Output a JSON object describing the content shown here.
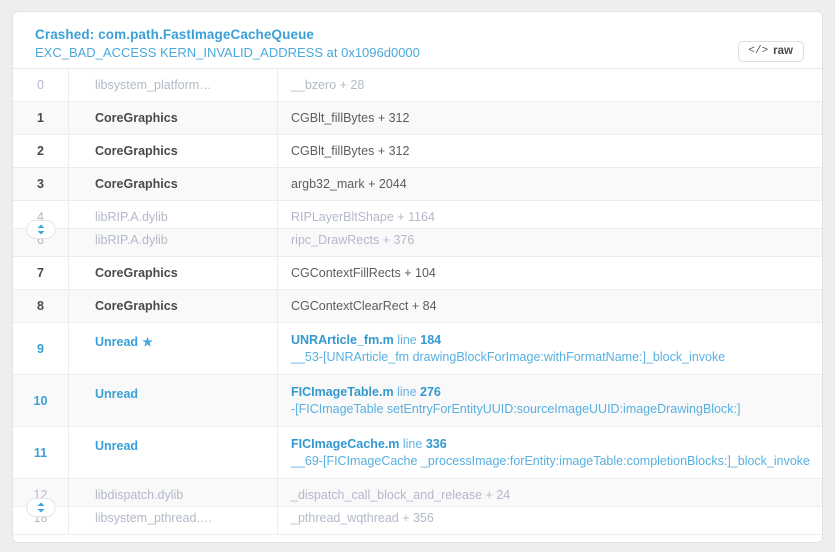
{
  "header": {
    "title": "Crashed: com.path.FastImageCacheQueue",
    "subtitle": "EXC_BAD_ACCESS KERN_INVALID_ADDRESS at 0x1096d0000",
    "raw_button": {
      "glyph": "</>",
      "label": "raw"
    },
    "colors": {
      "link": "#4aa9dd",
      "title": "#3aa0d8",
      "muted": "#b3b9c9",
      "emphasis": "#4a4a4a"
    }
  },
  "stack": {
    "rows": [
      {
        "index": "0",
        "library": "libsystem_platform…",
        "function": "__bzero + 28"
      },
      {
        "index": "1",
        "library": "CoreGraphics",
        "function": "CGBlt_fillBytes + 312"
      },
      {
        "index": "2",
        "library": "CoreGraphics",
        "function": "CGBlt_fillBytes + 312"
      },
      {
        "index": "3",
        "library": "CoreGraphics",
        "function": "argb32_mark + 2044"
      },
      {
        "index": "4",
        "library": "libRIP.A.dylib",
        "function": "RIPLayerBltShape + 1164"
      },
      {
        "index": "6",
        "library": "libRIP.A.dylib",
        "function": "ripc_DrawRects + 376"
      },
      {
        "index": "7",
        "library": "CoreGraphics",
        "function": "CGContextFillRects + 104"
      },
      {
        "index": "8",
        "library": "CoreGraphics",
        "function": "CGContextClearRect + 84"
      },
      {
        "index": "9",
        "library": "Unread",
        "starred": "★",
        "file": "UNRArticle_fm.m",
        "line_word": "line",
        "line_no": "184",
        "detail": "__53-[UNRArticle_fm drawingBlockForImage:withFormatName:]_block_invoke"
      },
      {
        "index": "10",
        "library": "Unread",
        "file": "FICImageTable.m",
        "line_word": "line",
        "line_no": "276",
        "detail": "-[FICImageTable setEntryForEntityUUID:sourceImageUUID:imageDrawingBlock:]"
      },
      {
        "index": "11",
        "library": "Unread",
        "file": "FICImageCache.m",
        "line_word": "line",
        "line_no": "336",
        "detail": "__69-[FICImageCache _processImage:forEntity:imageTable:completionBlocks:]_block_invoke"
      },
      {
        "index": "12",
        "library": "libdispatch.dylib",
        "function": "_dispatch_call_block_and_release + 24"
      },
      {
        "index": "18",
        "library": "libsystem_pthread.…",
        "function": "_pthread_wqthread + 356"
      }
    ],
    "expander_icon": "expand-collapse-icon"
  }
}
